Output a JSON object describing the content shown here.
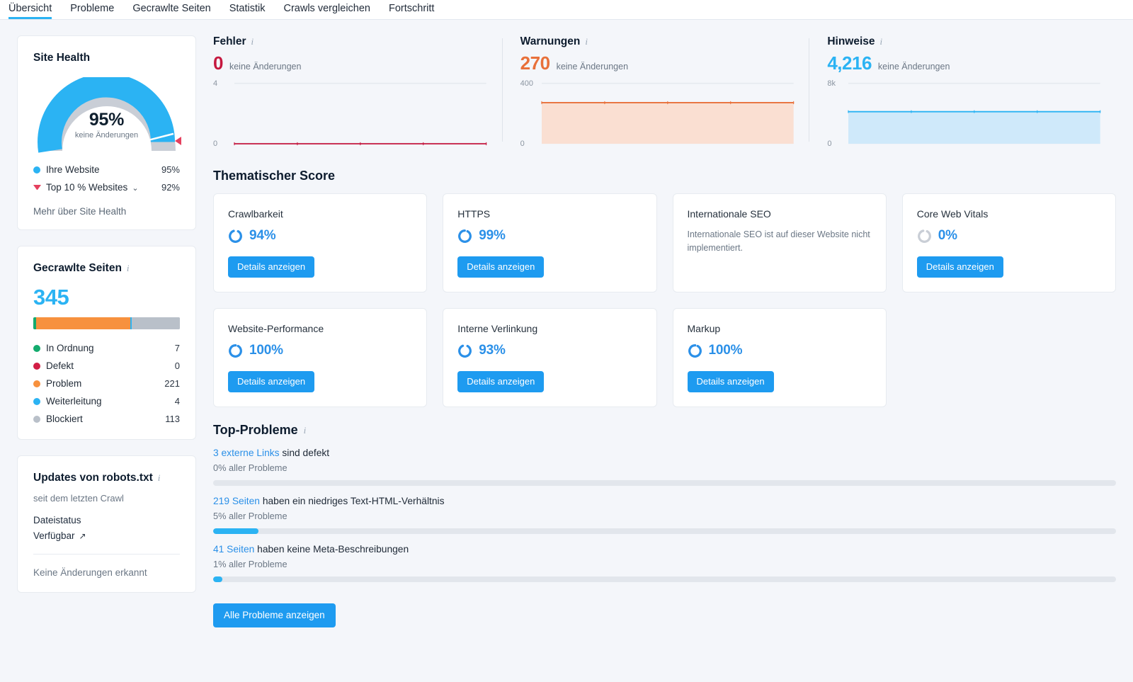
{
  "tabs": [
    {
      "label": "Übersicht",
      "active": true
    },
    {
      "label": "Probleme",
      "active": false
    },
    {
      "label": "Gecrawlte Seiten",
      "active": false
    },
    {
      "label": "Statistik",
      "active": false
    },
    {
      "label": "Crawls vergleichen",
      "active": false
    },
    {
      "label": "Fortschritt",
      "active": false
    }
  ],
  "site_health": {
    "title": "Site Health",
    "score": "95%",
    "change": "keine Änderungen",
    "legend": [
      {
        "label": "Ihre Website",
        "value": "95%",
        "color": "#2bb3f3",
        "marker": "dot"
      },
      {
        "label": "Top 10 % Websites",
        "value": "92%",
        "color": "#e5405e",
        "marker": "triangle",
        "chevron": "⌄"
      }
    ],
    "more_link": "Mehr über Site Health",
    "gauge": {
      "value": 95,
      "max": 100,
      "benchmark": 92,
      "arc_color": "#2bb3f3",
      "track_color": "#c9ced6",
      "marker_color": "#e5405e"
    }
  },
  "crawled_pages": {
    "title": "Gecrawlte Seiten",
    "total": "345",
    "segments": [
      {
        "label": "In Ordnung",
        "value": "7",
        "color": "#14ab6e",
        "pct": 2.0
      },
      {
        "label": "Defekt",
        "value": "0",
        "color": "#d21e45",
        "pct": 0
      },
      {
        "label": "Problem",
        "value": "221",
        "color": "#f7913e",
        "pct": 64.0
      },
      {
        "label": "Weiterleitung",
        "value": "4",
        "color": "#2bb3f3",
        "pct": 1.2
      },
      {
        "label": "Blockiert",
        "value": "113",
        "color": "#b9c0c9",
        "pct": 32.8
      }
    ]
  },
  "robots": {
    "title": "Updates von robots.txt",
    "subtitle": "seit dem letzten Crawl",
    "file_status_label": "Dateistatus",
    "file_status_value": "Verfügbar",
    "external_icon": "↗",
    "footer": "Keine Änderungen erkannt"
  },
  "metrics": [
    {
      "title": "Fehler",
      "value": "0",
      "change": "keine Änderungen",
      "color": "#c5183f",
      "fill": "none",
      "axis_top": "4",
      "axis_bottom": "0"
    },
    {
      "title": "Warnungen",
      "value": "270",
      "change": "keine Änderungen",
      "color": "#e8703a",
      "fill": "#fadfd2",
      "axis_top": "400",
      "axis_bottom": "0"
    },
    {
      "title": "Hinweise",
      "value": "4,216",
      "change": "keine Änderungen",
      "color": "#2bb3f3",
      "fill": "#cfe9fa",
      "axis_top": "8k",
      "axis_bottom": "0"
    }
  ],
  "chart_data": [
    {
      "type": "line",
      "title": "Fehler",
      "x": [
        1,
        2,
        3,
        4,
        5
      ],
      "series": [
        {
          "name": "Fehler",
          "values": [
            0,
            0,
            0,
            0,
            0
          ]
        }
      ],
      "ylim": [
        0,
        4
      ],
      "yticks": [
        "0",
        "4"
      ],
      "xlabel": "",
      "ylabel": "",
      "grid": true,
      "legend": "none",
      "color": "#c5183f"
    },
    {
      "type": "area",
      "title": "Warnungen",
      "x": [
        1,
        2,
        3,
        4,
        5
      ],
      "series": [
        {
          "name": "Warnungen",
          "values": [
            270,
            270,
            270,
            270,
            270
          ]
        }
      ],
      "ylim": [
        0,
        400
      ],
      "yticks": [
        "0",
        "400"
      ],
      "xlabel": "",
      "ylabel": "",
      "grid": true,
      "legend": "none",
      "color": "#e8703a"
    },
    {
      "type": "area",
      "title": "Hinweise",
      "x": [
        1,
        2,
        3,
        4,
        5
      ],
      "series": [
        {
          "name": "Hinweise",
          "values": [
            4216,
            4216,
            4216,
            4216,
            4216
          ]
        }
      ],
      "ylim": [
        0,
        8000
      ],
      "yticks": [
        "0",
        "8k"
      ],
      "xlabel": "",
      "ylabel": "",
      "grid": true,
      "legend": "none",
      "color": "#2bb3f3"
    }
  ],
  "thematic": {
    "heading": "Thematischer Score",
    "button_label": "Details anzeigen",
    "cards": [
      {
        "name": "Crawlbarkeit",
        "pct": "94%",
        "value": 94,
        "has_ring": true,
        "ring_color": "#2b90e8",
        "note": "",
        "has_button": true
      },
      {
        "name": "HTTPS",
        "pct": "99%",
        "value": 99,
        "has_ring": true,
        "ring_color": "#2b90e8",
        "note": "",
        "has_button": true
      },
      {
        "name": "Internationale SEO",
        "pct": "",
        "value": 0,
        "has_ring": false,
        "ring_color": "#c9ced6",
        "note": "Internationale SEO ist auf dieser Website nicht implementiert.",
        "has_button": false
      },
      {
        "name": "Core Web Vitals",
        "pct": "0%",
        "value": 0,
        "has_ring": true,
        "ring_color": "#c9ced6",
        "note": "",
        "has_button": true
      },
      {
        "name": "Website-Performance",
        "pct": "100%",
        "value": 100,
        "has_ring": true,
        "ring_color": "#2b90e8",
        "note": "",
        "has_button": true
      },
      {
        "name": "Interne Verlinkung",
        "pct": "93%",
        "value": 93,
        "has_ring": true,
        "ring_color": "#2b90e8",
        "note": "",
        "has_button": true
      },
      {
        "name": "Markup",
        "pct": "100%",
        "value": 100,
        "has_ring": true,
        "ring_color": "#2b90e8",
        "note": "",
        "has_button": true
      }
    ]
  },
  "top_issues": {
    "heading": "Top-Probleme",
    "all_button": "Alle Probleme anzeigen",
    "items": [
      {
        "link": "3 externe Links",
        "rest": " sind defekt",
        "sub": "0% aller Probleme",
        "pct": 0
      },
      {
        "link": "219 Seiten",
        "rest": " haben ein niedriges Text-HTML-Verhältnis",
        "sub": "5% aller Probleme",
        "pct": 5
      },
      {
        "link": "41 Seiten",
        "rest": " haben keine Meta-Beschreibungen",
        "sub": "1% aller Probleme",
        "pct": 1
      }
    ]
  }
}
